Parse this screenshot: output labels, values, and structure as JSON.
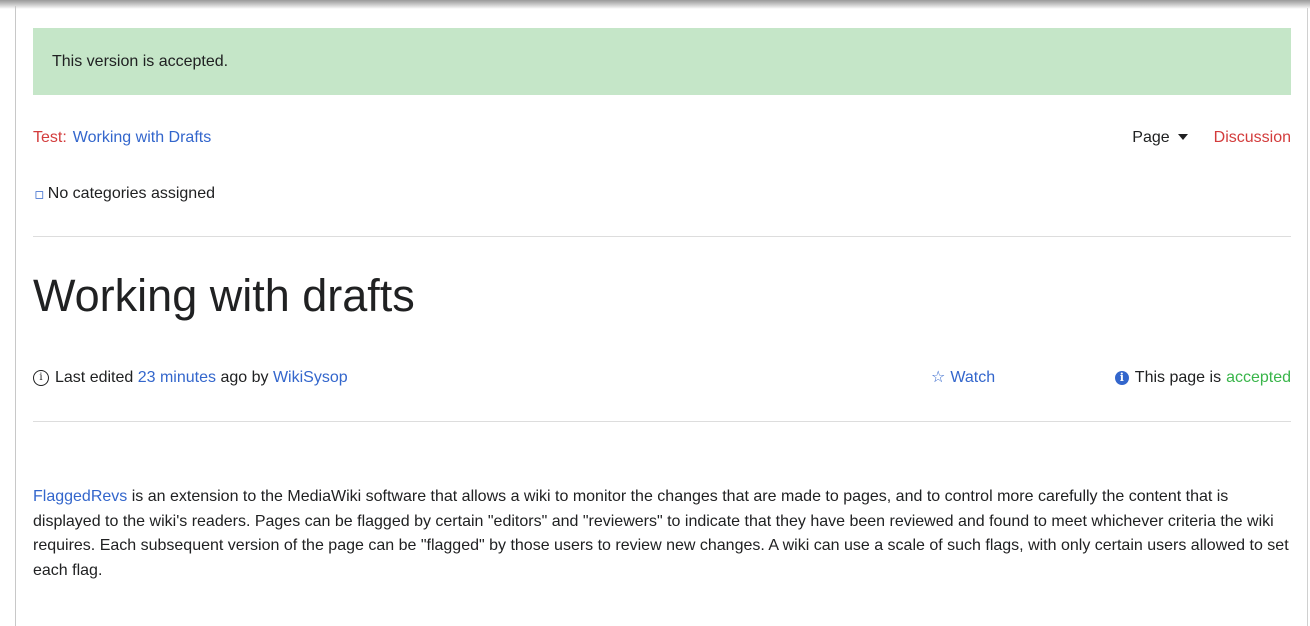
{
  "notice": {
    "text": "This version is accepted."
  },
  "breadcrumb": {
    "namespace": "Test:",
    "page": "Working with Drafts"
  },
  "tabs": {
    "page_label": "Page",
    "discussion_label": "Discussion"
  },
  "categories": {
    "icon": "tag-icon",
    "text": "No categories assigned"
  },
  "page": {
    "title": "Working with drafts"
  },
  "meta": {
    "prefix": "Last edited",
    "time_link": "23 minutes",
    "mid": "ago by",
    "user_link": "WikiSysop",
    "watch_label": "Watch",
    "status_prefix": "This page is",
    "status_value": "accepted"
  },
  "content": {
    "link": "FlaggedRevs",
    "text": " is an extension to the MediaWiki software that allows a wiki to monitor the changes that are made to pages, and to control more carefully the content that is displayed to the wiki's readers. Pages can be flagged by certain \"editors\" and \"reviewers\" to indicate that they have been reviewed and found to meet whichever criteria the wiki requires. Each subsequent version of the page can be \"flagged\" by those users to review new changes. A wiki can use a scale of such flags, with only certain users allowed to set each flag."
  },
  "colors": {
    "notice_bg": "#c5e6c8",
    "link": "#3366cc",
    "red_link": "#d33c3c",
    "accepted": "#39b54a"
  }
}
